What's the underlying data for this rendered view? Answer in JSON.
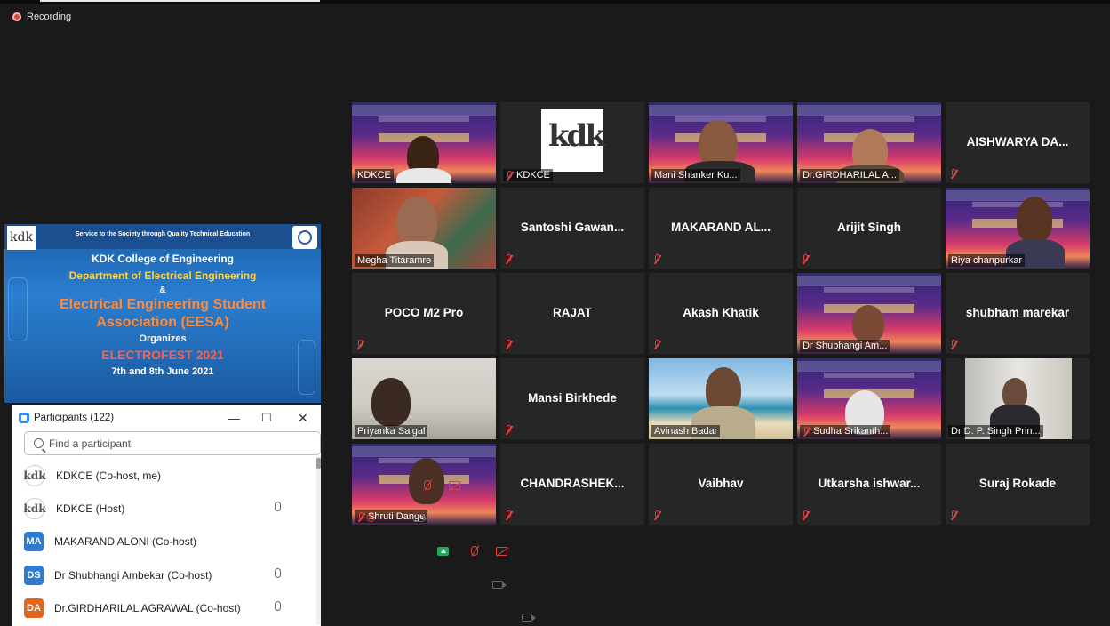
{
  "recording": {
    "label": "Recording"
  },
  "gallery": {
    "tiles": [
      {
        "name": "KDKCE",
        "kind": "video"
      },
      {
        "name": "KDKCE",
        "kind": "logo",
        "muted": true
      },
      {
        "name": "Mani Shanker Ku...",
        "kind": "video"
      },
      {
        "name": "Dr.GIRDHARILAL A...",
        "kind": "video"
      },
      {
        "center_name": "AISHWARYA  DA...",
        "muted": true
      },
      {
        "name": "Megha Titaramre",
        "kind": "video",
        "active": true
      },
      {
        "center_name": "Santoshi  Gawan...",
        "muted": true
      },
      {
        "center_name": "MAKARAND AL...",
        "muted": true
      },
      {
        "center_name": "Arijit Singh",
        "muted": true
      },
      {
        "name": "Riya chanpurkar",
        "kind": "video"
      },
      {
        "center_name": "POCO M2 Pro",
        "muted": true
      },
      {
        "center_name": "RAJAT",
        "muted": true
      },
      {
        "center_name": "Akash Khatik",
        "muted": true
      },
      {
        "name": "Dr Shubhangi Am...",
        "kind": "video"
      },
      {
        "center_name": "shubham marekar",
        "muted": true
      },
      {
        "name": "Priyanka Saigal",
        "kind": "video"
      },
      {
        "center_name": "Mansi  Birkhede",
        "muted": true
      },
      {
        "name": "Avinash Badar",
        "kind": "video"
      },
      {
        "name": "Sudha Srikanth...",
        "kind": "video",
        "muted": true
      },
      {
        "name": "Dr D. P. Singh Prin...",
        "kind": "video"
      },
      {
        "name": "Shruti Dange",
        "kind": "video",
        "muted": true
      },
      {
        "center_name": "CHANDRASHEK...",
        "muted": true
      },
      {
        "center_name": "Vaibhav",
        "muted": true
      },
      {
        "center_name": "Utkarsha  ishwar...",
        "muted": true
      },
      {
        "center_name": "Suraj Rokade",
        "muted": true
      }
    ]
  },
  "slide": {
    "tagline": "Service to the Society through Quality Technical Education",
    "college": "KDK College of Engineering",
    "department": "Department of Electrical Engineering",
    "amp": "&",
    "assoc_line1": "Electrical Engineering Student",
    "assoc_line2": "Association (EESA)",
    "organizes": "Organizes",
    "event": "ELECTROFEST 2021",
    "dates": "7th and 8th June 2021",
    "logo_text": "kdk"
  },
  "participants": {
    "title": "Participants (122)",
    "search_placeholder": "Find a participant",
    "list": [
      {
        "name": "KDKCE (Co-host, me)",
        "avatar": "kdk",
        "avatar_type": "logo",
        "icons": [
          "mic-muted",
          "cam-off"
        ]
      },
      {
        "name": "KDKCE (Host)",
        "avatar": "kdk",
        "avatar_type": "logo",
        "icons": [
          "recording",
          "mic",
          "cam"
        ]
      },
      {
        "name": "MAKARAND ALONI (Co-host)",
        "avatar": "MA",
        "avatar_color": "#2e7bd0",
        "icons": [
          "share",
          "mic-muted",
          "cam-off"
        ]
      },
      {
        "name": "Dr Shubhangi Ambekar (Co-host)",
        "avatar": "DS",
        "avatar_color": "#2e7bd0",
        "icons": [
          "mic",
          "cam"
        ]
      },
      {
        "name": "Dr.GIRDHARILAL AGRAWAL (Co-host)",
        "avatar": "DA",
        "avatar_color": "#e0661f",
        "icons": [
          "mic",
          "cam"
        ]
      }
    ]
  }
}
